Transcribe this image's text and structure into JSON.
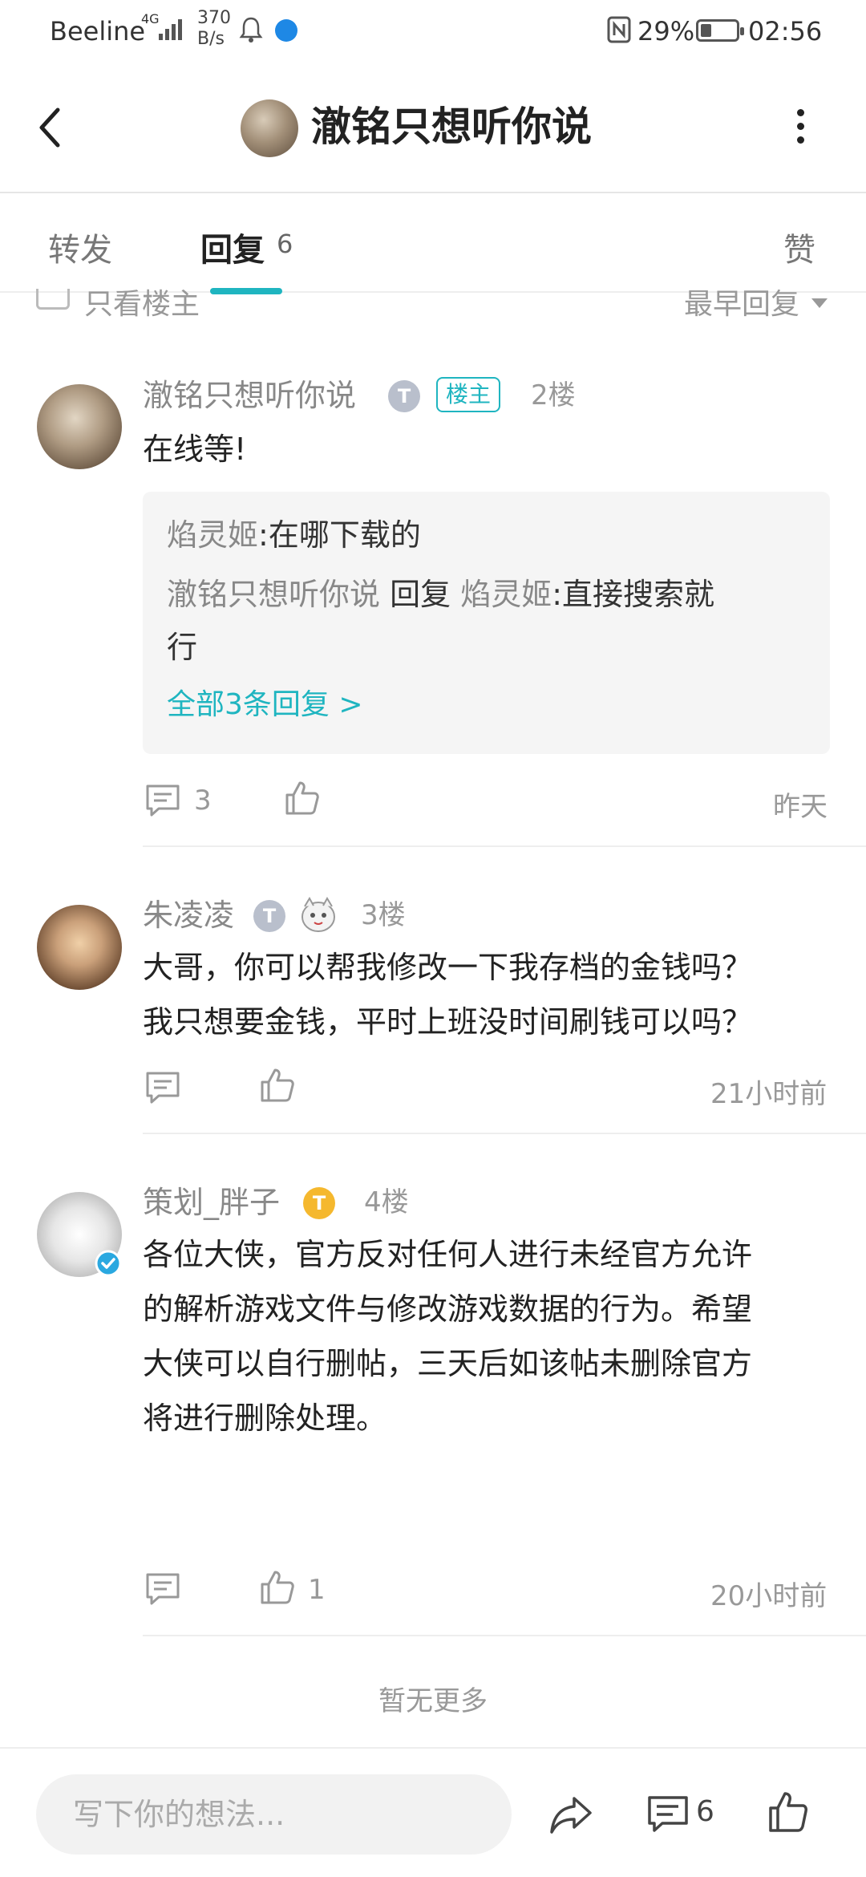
{
  "status": {
    "carrier": "Beeline",
    "network": "4G",
    "speed_value": "370",
    "speed_unit": "B/s",
    "battery": "29%",
    "time": "02:56"
  },
  "header": {
    "title": "澈铭只想听你说"
  },
  "tabs": {
    "forward": "转发",
    "reply": "回复",
    "reply_count": "6",
    "like": "赞"
  },
  "filter": {
    "only_owner": "只看楼主",
    "sort": "最早回复"
  },
  "posts": [
    {
      "name": "澈铭只想听你说",
      "level_badge": "T",
      "owner_tag": "楼主",
      "floor": "2楼",
      "text": "在线等!",
      "quotes": [
        {
          "name": "焰灵姬",
          "sep": ":",
          "text": "在哪下载的"
        },
        {
          "name": "澈铭只想听你说",
          "mid": "回复",
          "target": "焰灵姬",
          "sep": ":",
          "text_1": "直接搜索就",
          "text_2": "行"
        }
      ],
      "all_replies": "全部3条回复 >",
      "comment_count": "3",
      "time": "昨天"
    },
    {
      "name": "朱凌凌",
      "level_badge": "T",
      "floor": "3楼",
      "text_lines": [
        "大哥，你可以帮我修改一下我存档的金钱吗？",
        "我只想要金钱，平时上班没时间刷钱可以吗？"
      ],
      "time": "21小时前"
    },
    {
      "name": "策划_胖子",
      "level_badge": "T",
      "floor": "4楼",
      "text_lines": [
        "各位大侠，官方反对任何人进行未经官方允许",
        "的解析游戏文件与修改游戏数据的行为。希望",
        "大侠可以自行删帖，三天后如该帖未删除官方",
        "将进行删除处理。"
      ],
      "like_count": "1",
      "time": "20小时前"
    }
  ],
  "no_more": "暂无更多",
  "bottom": {
    "input_placeholder": "写下你的想法...",
    "comment_count": "6"
  },
  "colors": {
    "accent": "#1fb5c0",
    "badge_silver": "#b9bfcc",
    "badge_gold": "#f5b82e",
    "verified": "#2aa8e0"
  }
}
